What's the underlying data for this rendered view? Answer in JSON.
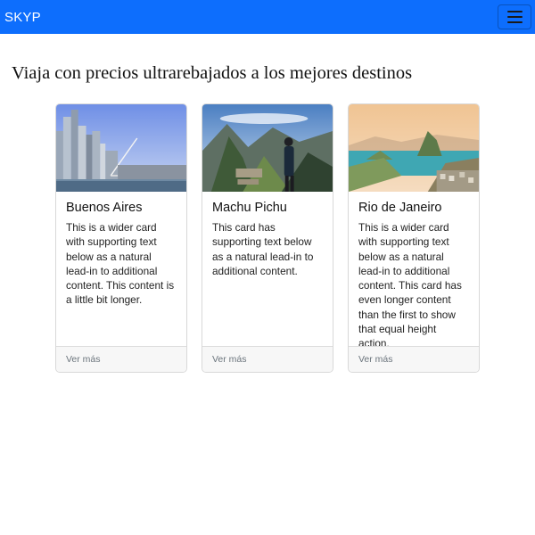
{
  "navbar": {
    "brand": "SKYP",
    "brand_color": "#0d6efd",
    "toggler_icon": "hamburger-icon"
  },
  "heading": "Viaja con precios ultrarebajados a los mejores destinos",
  "cards": [
    {
      "title": "Buenos Aires",
      "text": "This is a wider card with supporting text below as a natural lead-in to additional content. This content is a little bit longer.",
      "footer": "Ver más",
      "image_alt": "buenos-aires-skyline-image"
    },
    {
      "title": "Machu Pichu",
      "text": "This card has supporting text below as a natural lead-in to additional content.",
      "footer": "Ver más",
      "image_alt": "machu-picchu-mountain-image"
    },
    {
      "title": "Rio de Janeiro",
      "text": "This is a wider card with supporting text below as a natural lead-in to additional content. This card has even longer content than the first to show that equal height action.",
      "footer": "Ver más",
      "image_alt": "rio-de-janeiro-bay-image"
    }
  ]
}
